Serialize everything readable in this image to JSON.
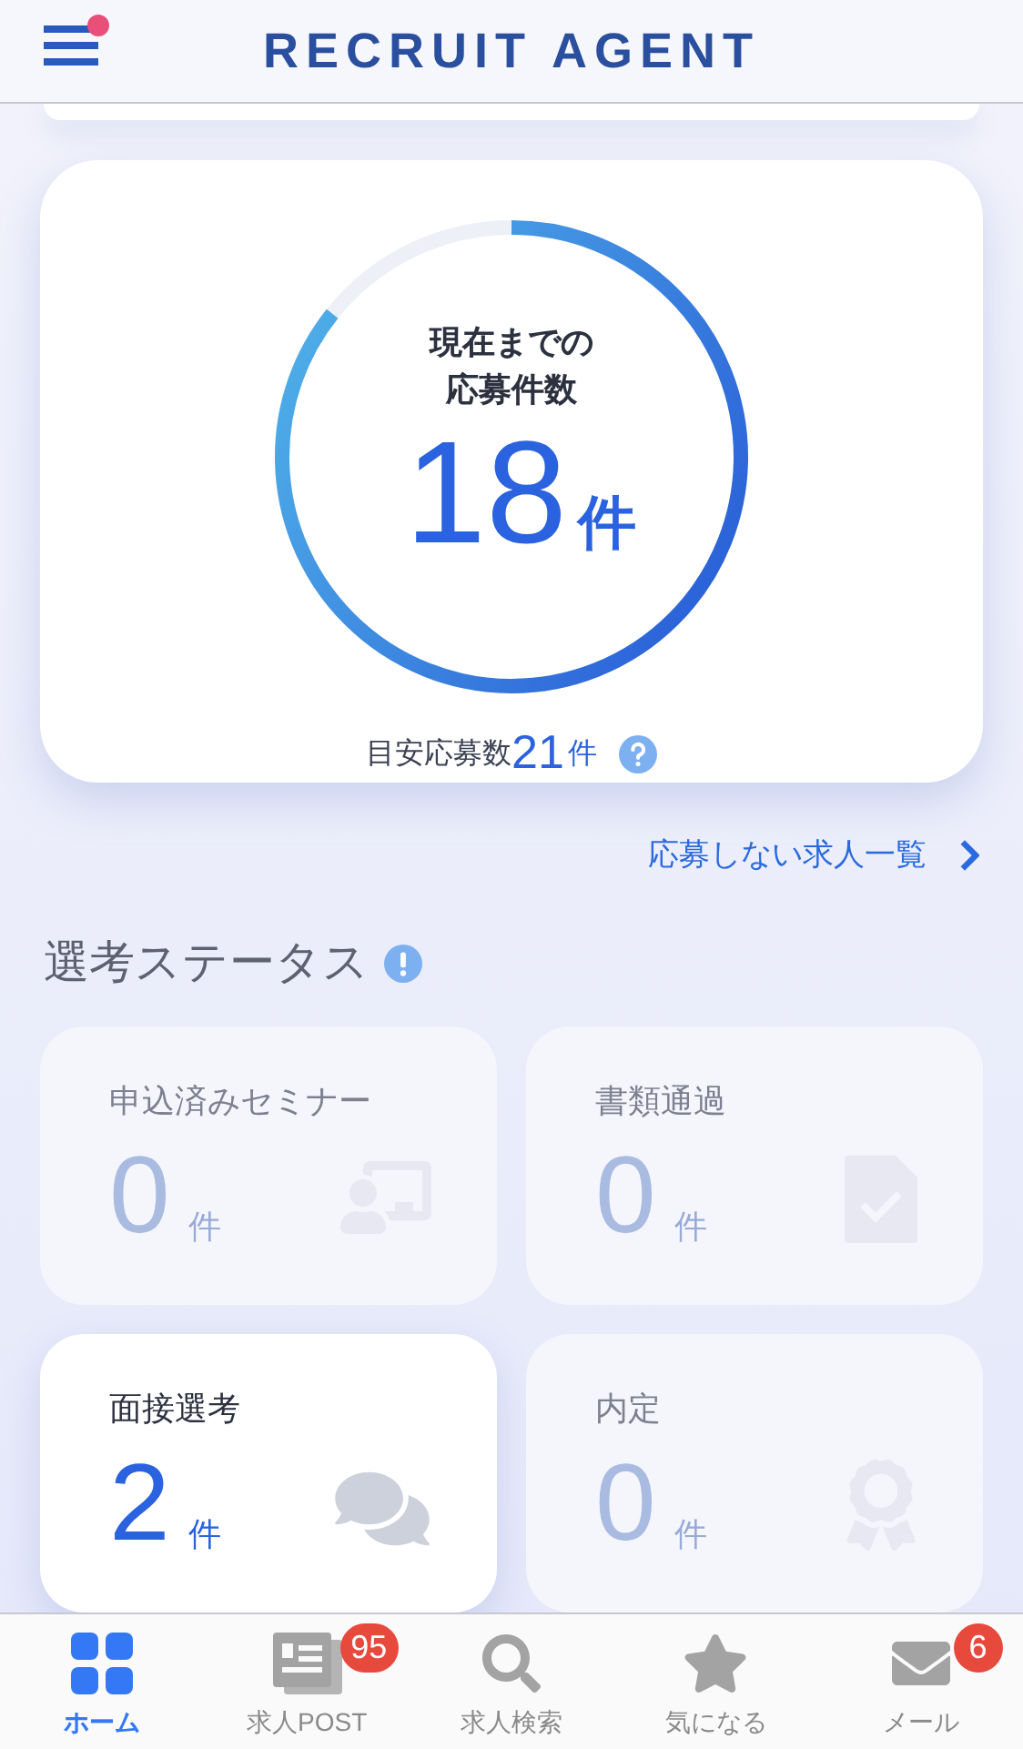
{
  "header": {
    "logo": "RECRUIT AGENT",
    "menu_notification": true
  },
  "applications": {
    "title_lines": [
      "現在までの",
      "応募件数"
    ],
    "count": "18",
    "unit": "件",
    "target_label": "目安応募数",
    "target_count": "21",
    "target_unit": "件"
  },
  "not_applied_link": "応募しない求人一覧",
  "selection_status": {
    "title": "選考ステータス",
    "items": [
      {
        "label": "申込済みセミナー",
        "count": "0",
        "unit": "件",
        "active": false,
        "kind": "seminar"
      },
      {
        "label": "書類通過",
        "count": "0",
        "unit": "件",
        "active": false,
        "kind": "document"
      },
      {
        "label": "面接選考",
        "count": "2",
        "unit": "件",
        "active": true,
        "kind": "interview"
      },
      {
        "label": "内定",
        "count": "0",
        "unit": "件",
        "active": false,
        "kind": "offer"
      }
    ]
  },
  "tabs": [
    {
      "label": "ホーム",
      "selected": true,
      "kind": "home"
    },
    {
      "label": "求人POST",
      "selected": false,
      "kind": "post",
      "badge": "95"
    },
    {
      "label": "求人検索",
      "selected": false,
      "kind": "search"
    },
    {
      "label": "気になる",
      "selected": false,
      "kind": "star"
    },
    {
      "label": "メール",
      "selected": false,
      "kind": "mail",
      "badge": "6"
    }
  ]
}
